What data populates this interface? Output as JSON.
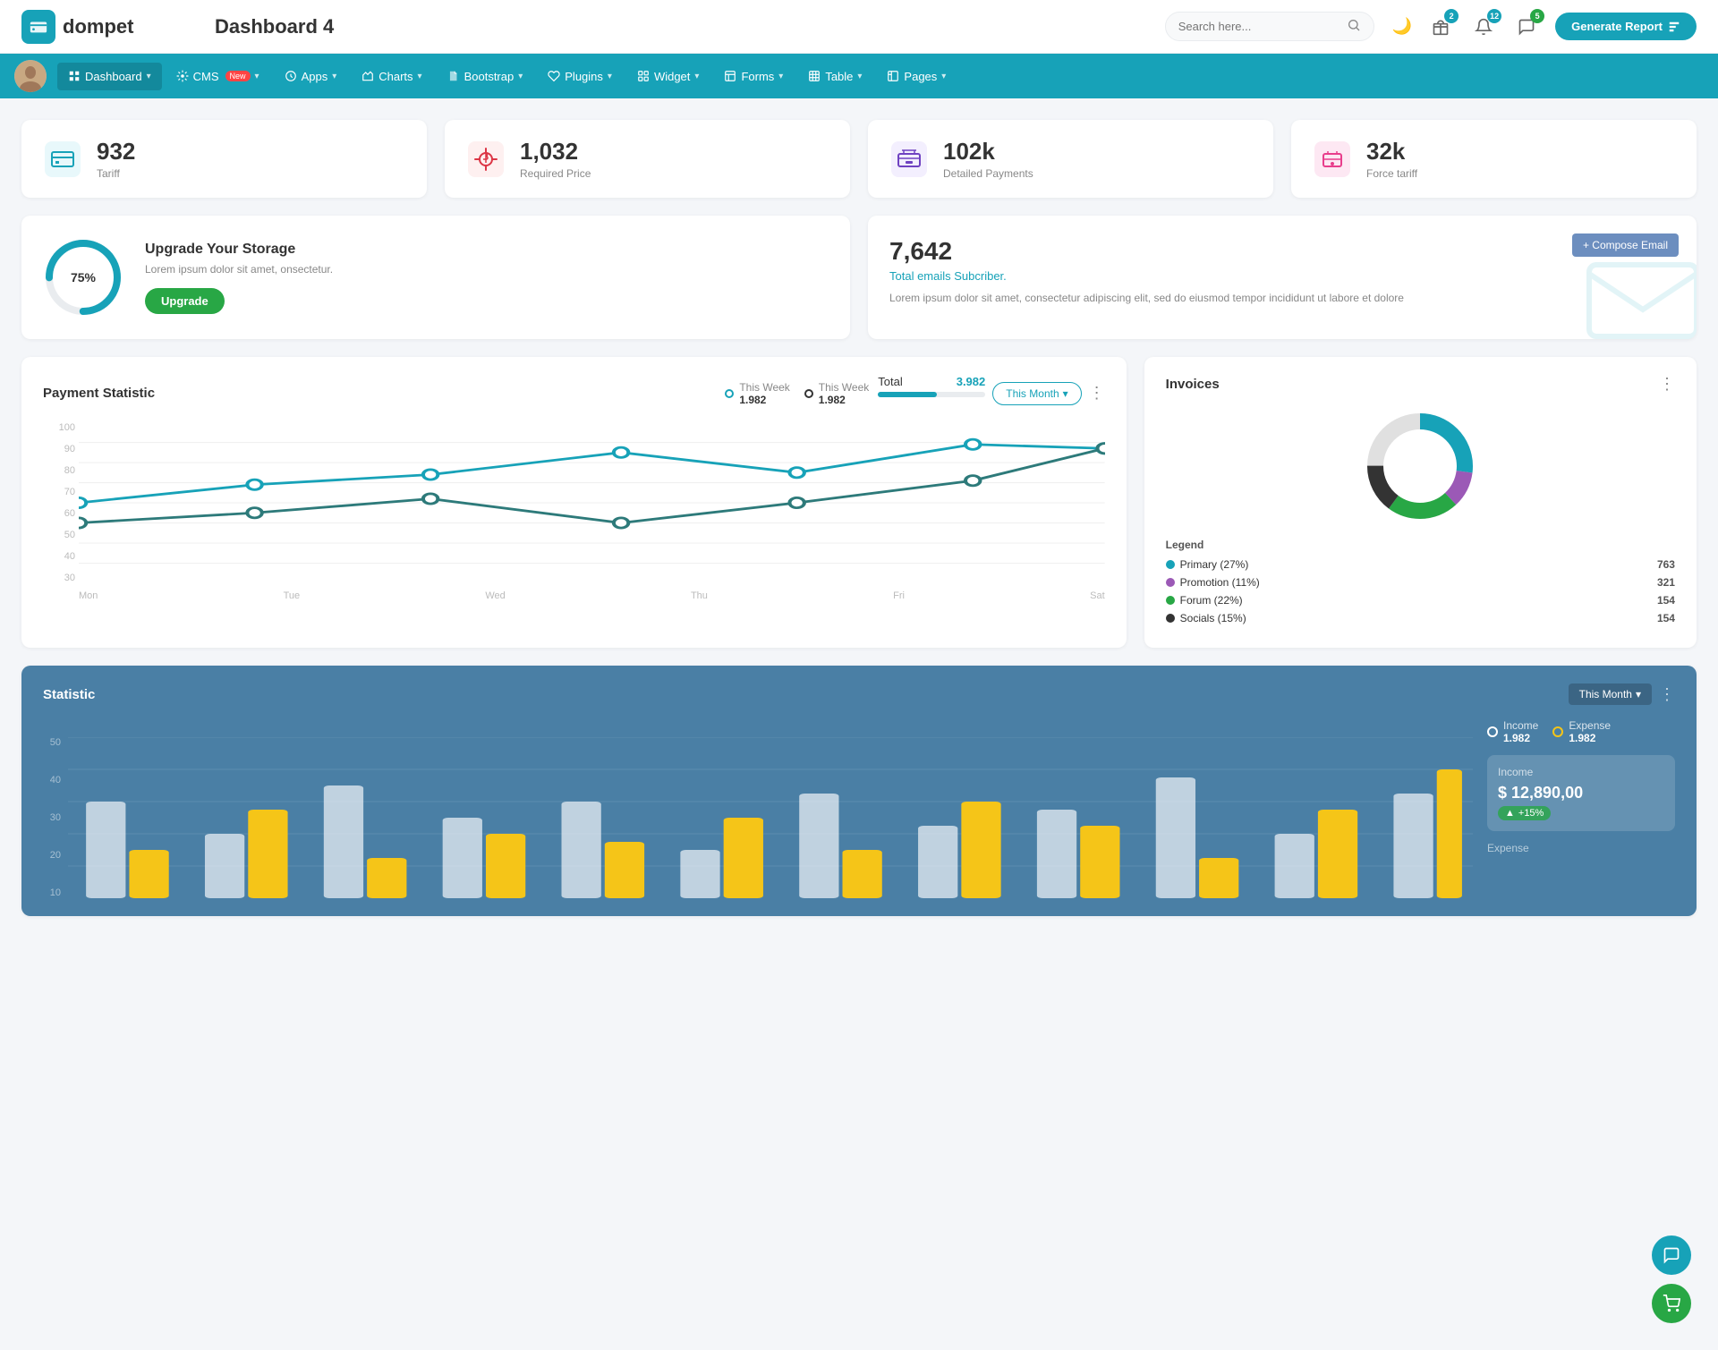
{
  "header": {
    "logo_text": "dompet",
    "page_title": "Dashboard 4",
    "search_placeholder": "Search here...",
    "generate_btn": "Generate Report",
    "badges": {
      "gift": "2",
      "bell": "12",
      "chat": "5"
    }
  },
  "nav": {
    "items": [
      {
        "id": "dashboard",
        "label": "Dashboard",
        "active": true,
        "has_arrow": true
      },
      {
        "id": "cms",
        "label": "CMS",
        "active": false,
        "has_badge": true,
        "badge_text": "New",
        "has_arrow": true
      },
      {
        "id": "apps",
        "label": "Apps",
        "active": false,
        "has_arrow": true
      },
      {
        "id": "charts",
        "label": "Charts",
        "active": false,
        "has_arrow": true
      },
      {
        "id": "bootstrap",
        "label": "Bootstrap",
        "active": false,
        "has_arrow": true
      },
      {
        "id": "plugins",
        "label": "Plugins",
        "active": false,
        "has_arrow": true
      },
      {
        "id": "widget",
        "label": "Widget",
        "active": false,
        "has_arrow": true
      },
      {
        "id": "forms",
        "label": "Forms",
        "active": false,
        "has_arrow": true
      },
      {
        "id": "table",
        "label": "Table",
        "active": false,
        "has_arrow": true
      },
      {
        "id": "pages",
        "label": "Pages",
        "active": false,
        "has_arrow": true
      }
    ]
  },
  "stat_cards": [
    {
      "id": "tariff",
      "value": "932",
      "label": "Tariff",
      "icon_color": "#17a2b8"
    },
    {
      "id": "required_price",
      "value": "1,032",
      "label": "Required Price",
      "icon_color": "#dc3545"
    },
    {
      "id": "detailed_payments",
      "value": "102k",
      "label": "Detailed Payments",
      "icon_color": "#6f42c1"
    },
    {
      "id": "force_tariff",
      "value": "32k",
      "label": "Force tariff",
      "icon_color": "#e83e8c"
    }
  ],
  "storage": {
    "percent": "75%",
    "title": "Upgrade Your Storage",
    "description": "Lorem ipsum dolor sit amet, onsectetur.",
    "btn_label": "Upgrade",
    "progress_value": 75
  },
  "email_section": {
    "count": "7,642",
    "subtitle": "Total emails Subcriber.",
    "description": "Lorem ipsum dolor sit amet, consectetur adipiscing elit, sed do eiusmod tempor incididunt ut labore et dolore",
    "compose_btn": "+ Compose Email"
  },
  "payment": {
    "title": "Payment Statistic",
    "filter_label": "This Month",
    "legend": [
      {
        "label": "This Week",
        "value": "1.982",
        "type": "teal"
      },
      {
        "label": "This Week",
        "value": "1.982",
        "type": "dark"
      }
    ],
    "total_label": "Total",
    "total_value": "3.982",
    "progress_percent": 55,
    "y_axis": [
      "100",
      "90",
      "80",
      "70",
      "60",
      "50",
      "40",
      "30"
    ],
    "x_axis": [
      "Mon",
      "Tue",
      "Wed",
      "Thu",
      "Fri",
      "Sat"
    ]
  },
  "invoices": {
    "title": "Invoices",
    "legend": [
      {
        "label": "Primary (27%)",
        "value": "763",
        "color": "#17a2b8"
      },
      {
        "label": "Promotion (11%)",
        "value": "321",
        "color": "#9b59b6"
      },
      {
        "label": "Forum (22%)",
        "value": "154",
        "color": "#28a745"
      },
      {
        "label": "Socials (15%)",
        "value": "154",
        "color": "#333"
      }
    ],
    "legend_title": "Legend",
    "donut": {
      "segments": [
        {
          "color": "#17a2b8",
          "percent": 27
        },
        {
          "color": "#9b59b6",
          "percent": 11
        },
        {
          "color": "#28a745",
          "percent": 22
        },
        {
          "color": "#333",
          "percent": 15
        },
        {
          "color": "#e0e0e0",
          "percent": 25
        }
      ]
    }
  },
  "statistic": {
    "title": "Statistic",
    "filter_label": "This Month",
    "legend": [
      {
        "label": "Income",
        "value": "1.982",
        "type": "white"
      },
      {
        "label": "Expense",
        "value": "1.982",
        "type": "yellow"
      }
    ],
    "income_box": {
      "title": "Income",
      "amount": "$ 12,890,00",
      "badge": "+15%"
    },
    "expense_label": "Expense",
    "y_labels": [
      "50",
      "40",
      "30",
      "20",
      "10"
    ],
    "bars": [
      {
        "white": 60,
        "yellow": 30
      },
      {
        "white": 35,
        "yellow": 55
      },
      {
        "white": 70,
        "yellow": 25
      },
      {
        "white": 45,
        "yellow": 40
      },
      {
        "white": 55,
        "yellow": 35
      },
      {
        "white": 30,
        "yellow": 50
      },
      {
        "white": 65,
        "yellow": 30
      },
      {
        "white": 40,
        "yellow": 60
      },
      {
        "white": 50,
        "yellow": 45
      },
      {
        "white": 75,
        "yellow": 25
      },
      {
        "white": 35,
        "yellow": 55
      },
      {
        "white": 55,
        "yellow": 70
      }
    ]
  },
  "fab": {
    "chat_label": "Chat support",
    "cart_label": "Shopping cart"
  }
}
